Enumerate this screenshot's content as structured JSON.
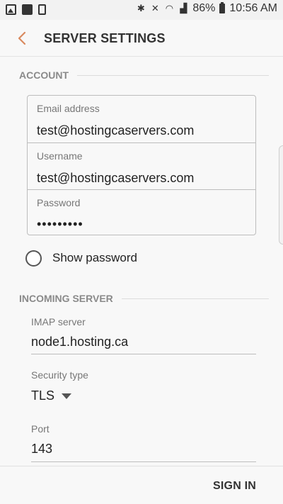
{
  "status_bar": {
    "battery": "86%",
    "time": "10:56 AM"
  },
  "header": {
    "title": "SERVER SETTINGS"
  },
  "account": {
    "heading": "ACCOUNT",
    "email_label": "Email address",
    "email_value": "test@hostingcaservers.com",
    "username_label": "Username",
    "username_value": "test@hostingcaservers.com",
    "password_label": "Password",
    "password_value": "•••••••••",
    "show_password_label": "Show password"
  },
  "incoming": {
    "heading": "INCOMING SERVER",
    "imap_label": "IMAP server",
    "imap_value": "node1.hosting.ca",
    "security_label": "Security type",
    "security_value": "TLS",
    "port_label": "Port",
    "port_value": "143"
  },
  "footer": {
    "sign_in": "SIGN IN"
  },
  "colors": {
    "accent_back_arrow": "#d98a5f",
    "background": "#f8f8f8"
  }
}
